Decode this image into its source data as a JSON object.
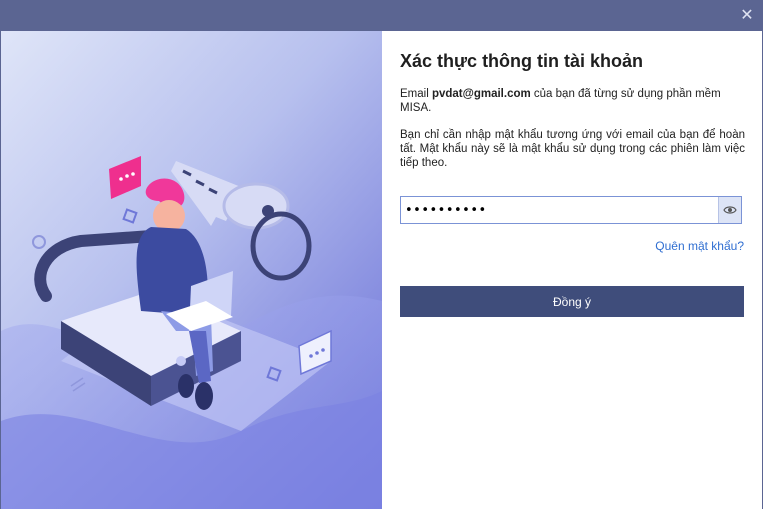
{
  "window": {
    "close_icon": "close-icon"
  },
  "dialog": {
    "title": "Xác thực thông tin tài khoản",
    "email_prefix": "Email ",
    "email": "pvdat@gmail.com",
    "email_suffix": " của bạn đã từng sử dụng phần mềm MISA.",
    "instruction": "Bạn chỉ cần nhập mật khẩu tương ứng với email của bạn để hoàn tất. Mật khẩu này sẽ là mật khẩu sử dụng trong các phiên làm việc tiếp theo.",
    "password_value": "••••••••••",
    "show_password_icon": "eye-icon",
    "forgot_link": "Quên mật khẩu?",
    "submit_label": "Đồng ý"
  },
  "illustration": {
    "chat_bubble_icon": "chat-bubble-icon",
    "key_icon": "key-icon",
    "lock_icon": "padlock-icon"
  }
}
